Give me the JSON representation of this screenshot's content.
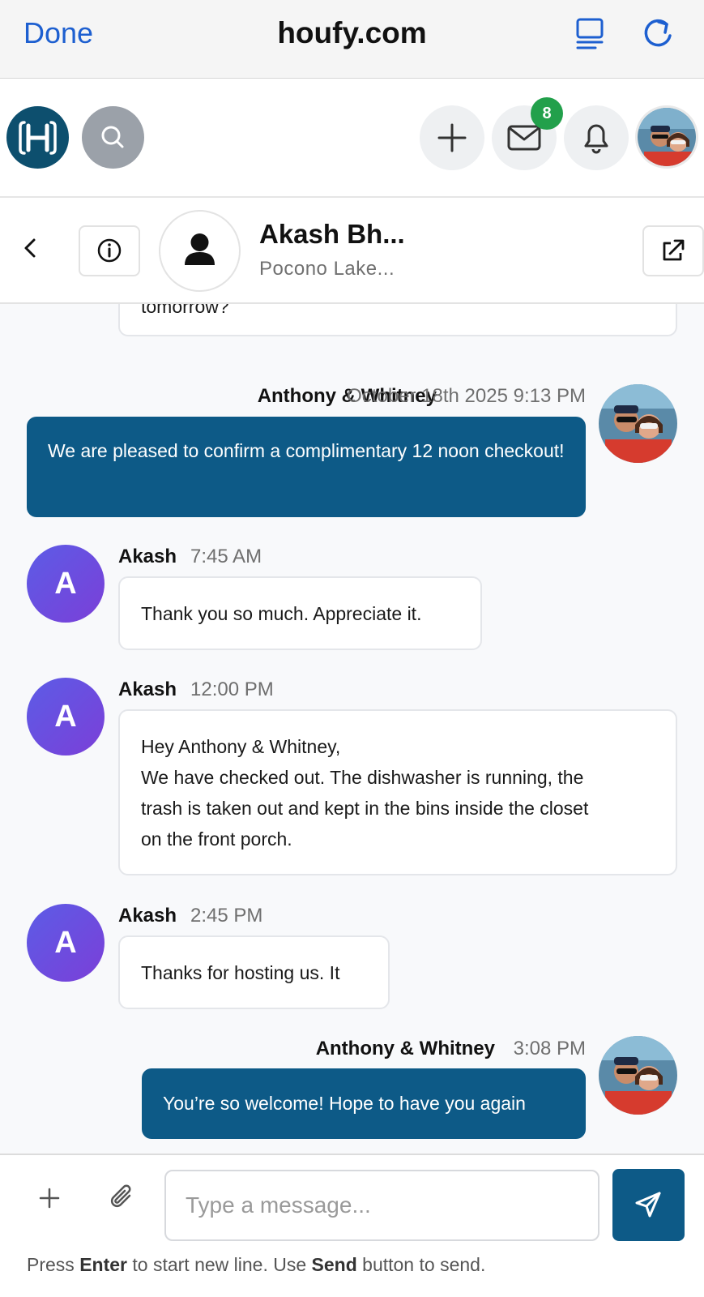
{
  "browser": {
    "done_label": "Done",
    "url": "houfy.com"
  },
  "header": {
    "messages_badge": "8"
  },
  "conversation": {
    "contact_name": "Akash Bh...",
    "contact_subtitle": "Pocono Lake..."
  },
  "messages": [
    {
      "text": "tomorrow?"
    },
    {
      "sender": "Anthony & Whitney",
      "time": "October 18th 2025 9:13 PM",
      "text": "We are pleased to confirm a complimentary 12 noon checkout!"
    },
    {
      "sender": "Akash",
      "avatar_letter": "A",
      "time": "7:45 AM",
      "text": "Thank you so much. Appreciate it."
    },
    {
      "sender": "Akash",
      "avatar_letter": "A",
      "time": "12:00 PM",
      "lines": [
        "Hey Anthony & Whitney,",
        "We have checked out. The dishwasher is running, the",
        "trash is taken out and kept in the bins inside the closet",
        "on the front porch."
      ]
    },
    {
      "sender": "Akash",
      "avatar_letter": "A",
      "time": "2:45 PM",
      "text": "Thanks for hosting us. It"
    },
    {
      "sender": "Anthony & Whitney",
      "time": "3:08 PM",
      "text": "You’re so welcome! Hope to have you again"
    }
  ],
  "composer": {
    "placeholder": "Type a message...",
    "hint_prefix": "Press",
    "hint_key1": "Enter",
    "hint_mid": "to start new line. Use",
    "hint_key2": "Send",
    "hint_suffix": "button to send."
  },
  "colors": {
    "accent": "#0d5a87",
    "brand_blue": "#1d5fd0",
    "badge_green": "#22a04b",
    "avatar_gradient_start": "#5c5ce6",
    "avatar_gradient_end": "#7b3fd8"
  },
  "icons": [
    "tabs-icon",
    "reload-icon",
    "houfy-logo-icon",
    "search-icon",
    "plus-icon",
    "mail-icon",
    "bell-icon",
    "back-chevron-icon",
    "info-icon",
    "person-icon",
    "external-link-icon",
    "paperclip-icon",
    "send-icon"
  ]
}
